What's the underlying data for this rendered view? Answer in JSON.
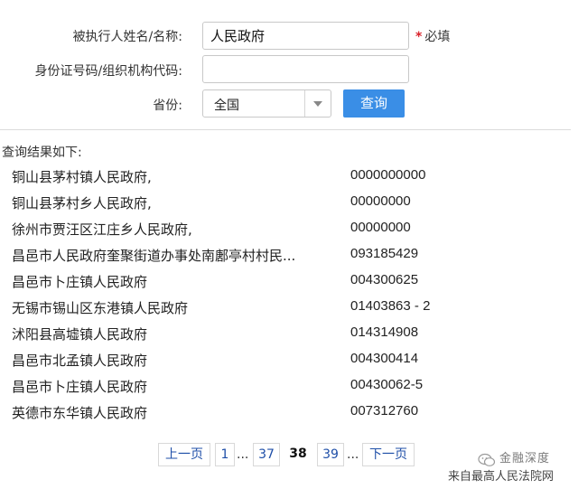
{
  "form": {
    "name_label": "被执行人姓名/名称:",
    "name_value": "人民政府",
    "required_star": "*",
    "required_text": "必填",
    "id_label": "身份证号码/组织机构代码:",
    "id_value": "",
    "province_label": "省份:",
    "province_value": "全国",
    "search_label": "查询"
  },
  "results": {
    "title": "查询结果如下:",
    "rows": [
      {
        "name": "铜山县茅村镇人民政府,",
        "code": "0000000000"
      },
      {
        "name": "铜山县茅村乡人民政府,",
        "code": "00000000"
      },
      {
        "name": "徐州市贾汪区江庄乡人民政府,",
        "code": "00000000"
      },
      {
        "name": "昌邑市人民政府奎聚街道办事处南鄌亭村村民...",
        "code": "093185429"
      },
      {
        "name": "昌邑市卜庄镇人民政府",
        "code": "004300625"
      },
      {
        "name": "无锡市锡山区东港镇人民政府",
        "code": "01403863 - 2"
      },
      {
        "name": "沭阳县高墟镇人民政府",
        "code": "014314908"
      },
      {
        "name": "昌邑市北孟镇人民政府",
        "code": "004300414"
      },
      {
        "name": "昌邑市卜庄镇人民政府",
        "code": "00430062-5"
      },
      {
        "name": "英德市东华镇人民政府",
        "code": "007312760"
      }
    ]
  },
  "pagination": {
    "prev": "上一页",
    "first": "1",
    "ellipsis": "...",
    "p37": "37",
    "current": "38",
    "p39": "39",
    "next": "下一页"
  },
  "watermark": {
    "brand": "金融深度",
    "source": "来自最高人民法院网"
  }
}
